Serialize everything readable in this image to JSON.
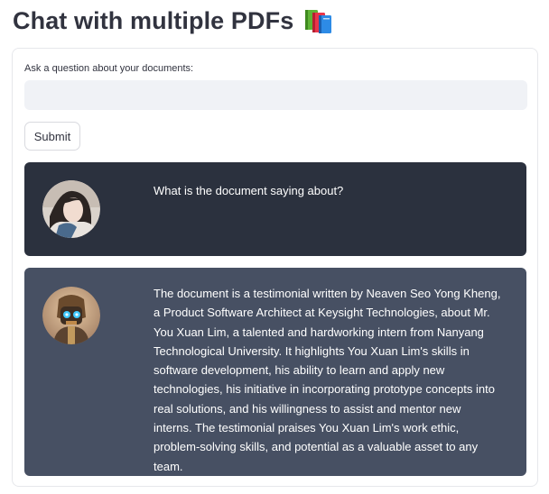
{
  "page": {
    "title": "Chat with multiple PDFs",
    "title_icon": "books-emoji-icon"
  },
  "form": {
    "question_label": "Ask a question about your documents:",
    "question_value": "",
    "submit_label": "Submit"
  },
  "messages": [
    {
      "role": "user",
      "avatar": "user-avatar",
      "text": "What is the document saying about?"
    },
    {
      "role": "bot",
      "avatar": "bot-avatar",
      "text": "The document is a testimonial written by Neaven Seo Yong Kheng, a Product Software Architect at Keysight Technologies, about Mr. You Xuan Lim, a talented and hardworking intern from Nanyang Technological University. It highlights You Xuan Lim's skills in software development, his ability to learn and apply new technologies, his initiative in incorporating prototype concepts into real solutions, and his willingness to assist and mentor new interns. The testimonial praises You Xuan Lim's work ethic, problem-solving skills, and potential as a valuable asset to any team."
    }
  ],
  "colors": {
    "user_bubble": "#2b313e",
    "bot_bubble": "#475063",
    "input_bg": "#f0f2f6",
    "text": "#31333f"
  }
}
